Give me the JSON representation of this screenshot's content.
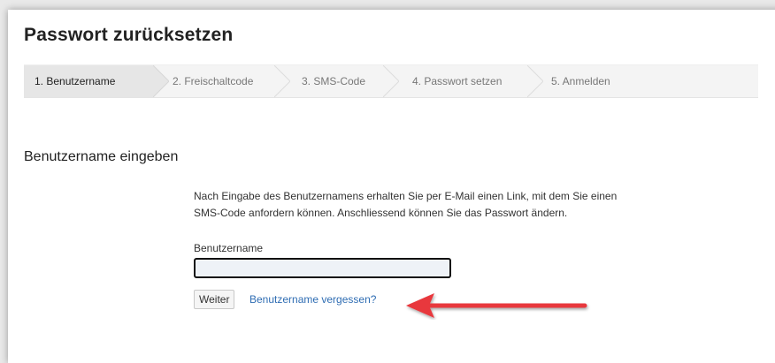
{
  "page": {
    "title": "Passwort zurücksetzen"
  },
  "stepper": {
    "steps": [
      {
        "label": "1. Benutzername",
        "active": true
      },
      {
        "label": "2. Freischaltcode",
        "active": false
      },
      {
        "label": "3. SMS-Code",
        "active": false
      },
      {
        "label": "4. Passwort setzen",
        "active": false
      },
      {
        "label": "5. Anmelden",
        "active": false
      }
    ]
  },
  "section": {
    "title": "Benutzername eingeben",
    "intro_line1": "Nach Eingabe des Benutzernamens erhalten Sie per E-Mail einen Link, mit dem Sie einen",
    "intro_line2": "SMS-Code anfordern können. Anschliessend können Sie das Passwort ändern."
  },
  "form": {
    "username_label": "Benutzername",
    "username_value": "",
    "submit_label": "Weiter",
    "forgot_link": "Benutzername vergessen?"
  },
  "annotation": {
    "arrow_color": "#e8383d"
  }
}
